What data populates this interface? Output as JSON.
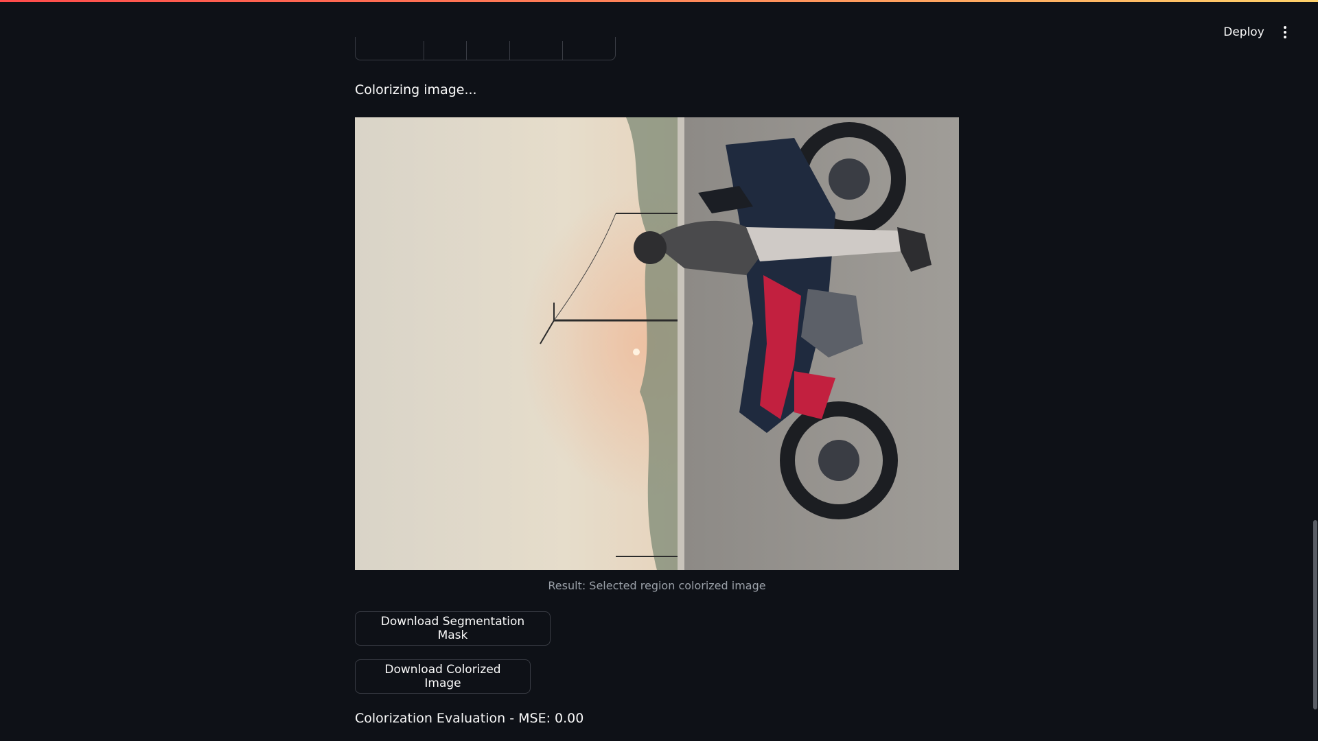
{
  "header": {
    "deploy_label": "Deploy",
    "menu_icon": "vertical-ellipsis-icon"
  },
  "main": {
    "status_text": "Colorizing image...",
    "image_caption": "Result: Selected region colorized image",
    "buttons": {
      "download_mask": "Download Segmentation Mask",
      "download_colorized": "Download Colorized Image"
    },
    "evaluation_text": "Colorization Evaluation - MSE: 0.00"
  },
  "colors": {
    "background": "#0e1117",
    "text": "#fafafa",
    "caption": "#9aa0a8",
    "border": "#3a3d45",
    "accent_gradient_start": "#ff4b4b",
    "accent_gradient_end": "#ffd26a"
  }
}
